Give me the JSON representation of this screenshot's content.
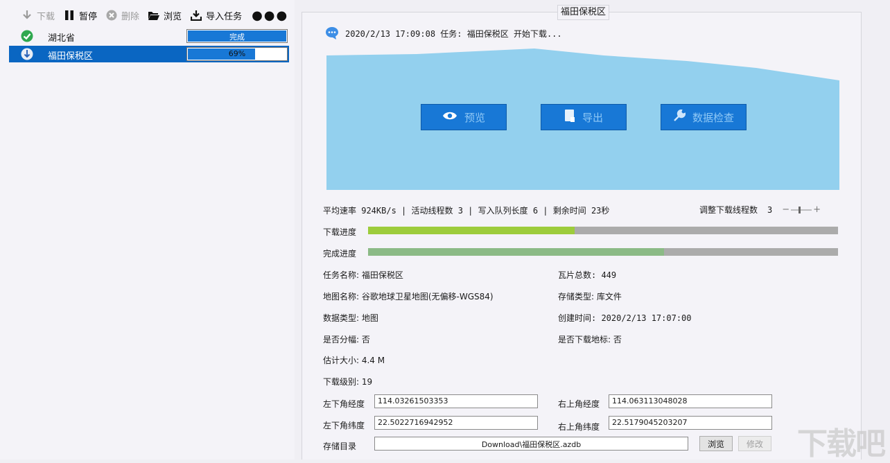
{
  "toolbar": {
    "download": "下载",
    "pause": "暂停",
    "delete": "删除",
    "browse": "浏览",
    "import": "导入任务",
    "more": "●●●"
  },
  "tasks": [
    {
      "name": "湖北省",
      "progress_text": "完成",
      "progress": 1.0,
      "status_icon": "check-circle-icon"
    },
    {
      "name": "福田保税区",
      "progress_text": "69%",
      "progress": 0.69,
      "status_icon": "downloading-icon"
    }
  ],
  "panel": {
    "title": "福田保税区",
    "message": "2020/2/13  17:09:08  任务: 福田保税区  开始下载...",
    "actions": {
      "preview": "预览",
      "export": "导出",
      "check": "数据检查"
    },
    "stats": "平均速率  924KB/s  | 活动线程数  3  | 写入队列长度  6  | 剩余时间  23秒",
    "threads_label": "调整下载线程数",
    "threads_value": "3",
    "download_progress_label": "下载进度",
    "download_progress": 0.44,
    "complete_progress_label": "完成进度",
    "complete_progress": 0.63,
    "colors": {
      "download": "#9dcc3c",
      "complete": "#8bba86",
      "banner": "#93d0ee",
      "button": "#1878d6"
    }
  },
  "info": {
    "task_name": "任务名称: 福田保税区",
    "tile_total": "瓦片总数: 449",
    "map_name": "地图名称:  谷歌地球卫星地图(无偏移-WGS84)",
    "storage_type": "存储类型: 库文件",
    "data_type": "数据类型: 地图",
    "created": "创建时间: 2020/2/13 17:07:00",
    "split": "是否分幅: 否",
    "landmark": "是否下载地标: 否",
    "size": "估计大小:  4.4 M",
    "level": "下载级别: 19"
  },
  "coords": {
    "ll_lon_label": "左下角经度",
    "ll_lon": "114.03261503353",
    "ur_lon_label": "右上角经度",
    "ur_lon": "114.063113048028",
    "ll_lat_label": "左下角纬度",
    "ll_lat": "22.5022716942952",
    "ur_lat_label": "右上角纬度",
    "ur_lat": "22.5179045203207",
    "dir_label": "存储目录",
    "dir_value": "Download\\福田保税区.azdb",
    "browse_btn": "浏览",
    "modify_btn": "修改"
  },
  "watermark": "下载吧"
}
